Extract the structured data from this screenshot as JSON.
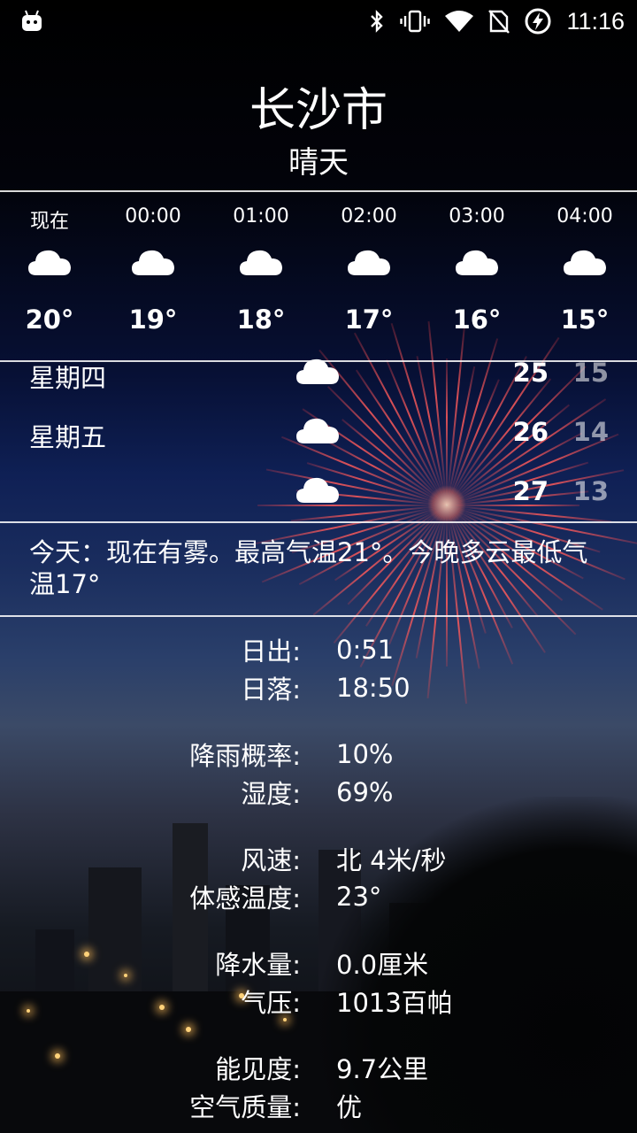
{
  "status_bar": {
    "time": "11:16",
    "icons": [
      "android-icon",
      "bluetooth-icon",
      "vibrate-icon",
      "wifi-icon",
      "no-sim-icon",
      "battery-charging-icon"
    ]
  },
  "header": {
    "city": "长沙市",
    "condition": "晴天"
  },
  "hourly": [
    {
      "time": "现在",
      "icon": "cloud-icon",
      "temp": "20°"
    },
    {
      "time": "00:00",
      "icon": "cloud-icon",
      "temp": "19°"
    },
    {
      "time": "01:00",
      "icon": "cloud-icon",
      "temp": "18°"
    },
    {
      "time": "02:00",
      "icon": "cloud-icon",
      "temp": "17°"
    },
    {
      "time": "03:00",
      "icon": "cloud-icon",
      "temp": "16°"
    },
    {
      "time": "04:00",
      "icon": "cloud-icon",
      "temp": "15°"
    }
  ],
  "daily": [
    {
      "day": "星期四",
      "icon": "cloud-icon",
      "high": "25",
      "low": "15"
    },
    {
      "day": "星期五",
      "icon": "cloud-icon",
      "high": "26",
      "low": "14"
    },
    {
      "day": "",
      "icon": "cloud-icon",
      "high": "27",
      "low": "13"
    }
  ],
  "summary": "今天：现在有雾。最高气温21°。今晚多云最低气温17°",
  "details": [
    [
      {
        "key": "日出:",
        "value": "0:51"
      },
      {
        "key": "日落:",
        "value": "18:50"
      }
    ],
    [
      {
        "key": "降雨概率:",
        "value": "10%"
      },
      {
        "key": "湿度:",
        "value": "69%"
      }
    ],
    [
      {
        "key": "风速:",
        "value": "北 4米/秒"
      },
      {
        "key": "体感温度:",
        "value": "23°"
      }
    ],
    [
      {
        "key": "降水量:",
        "value": "0.0厘米"
      },
      {
        "key": "气压:",
        "value": "1013百帕"
      }
    ],
    [
      {
        "key": "能见度:",
        "value": "9.7公里"
      },
      {
        "key": "空气质量:",
        "value": "优"
      }
    ]
  ]
}
